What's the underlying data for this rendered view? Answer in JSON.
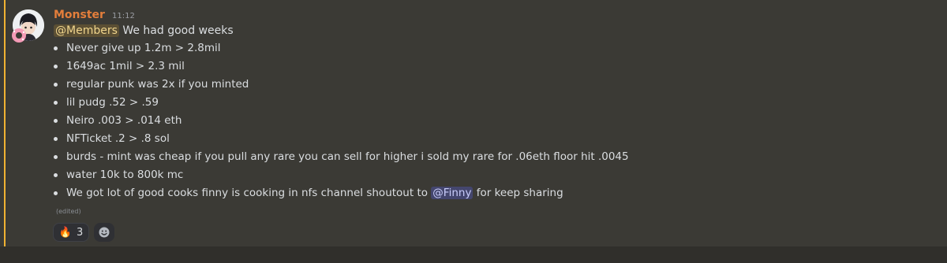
{
  "message": {
    "username": "Monster",
    "timestamp": "11:12",
    "mention_members": "@Members",
    "intro_text": " We had good weeks",
    "bullets": [
      "Never give up 1.2m > 2.8mil",
      "1649ac 1mil > 2.3 mil",
      "regular punk was 2x if you minted",
      "lil pudg .52 > .59",
      "Neiro .003 > .014 eth",
      "NFTicket .2 > .8 sol",
      "burds - mint was cheap if you pull any rare you can sell for higher i sold my rare for .06eth floor hit .0045",
      "water 10k to 800k mc"
    ],
    "last_bullet": {
      "before": "We got lot of good cooks finny is cooking in nfs channel shoutout to ",
      "mention": "@Finny",
      "after": " for keep sharing"
    },
    "edited_label": "(edited)",
    "reaction": {
      "emoji": "🔥",
      "icon": "fire-icon",
      "count": "3"
    },
    "add_reaction_icon": "add-reaction-icon",
    "colors": {
      "username": "#e37e3b",
      "accent": "#f0b232",
      "mention": "#c9cdfb"
    }
  }
}
